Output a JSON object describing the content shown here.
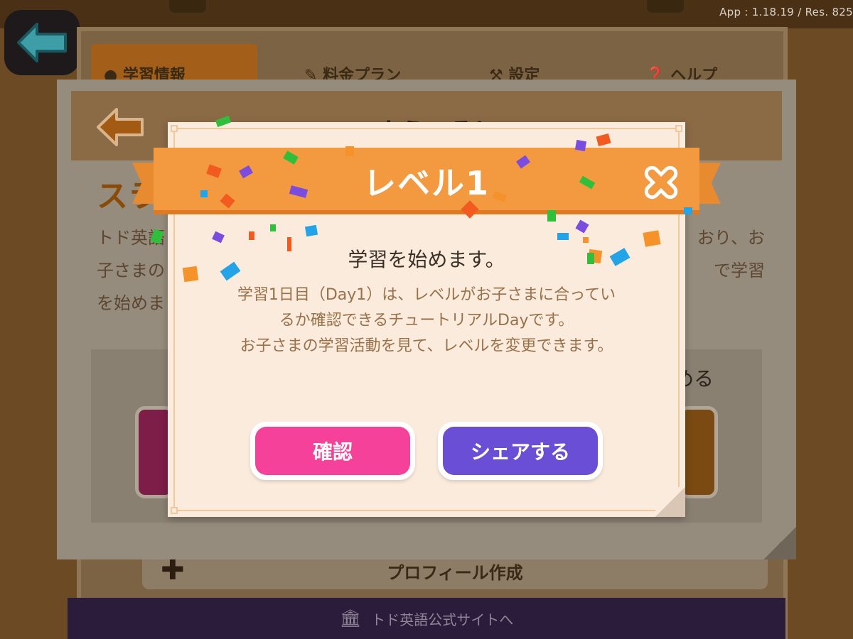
{
  "app": {
    "version": "App : 1.18.19 / Res. 825"
  },
  "background": {
    "tabs": [
      "学習情報",
      "料金プラン",
      "設定",
      "ヘルプ"
    ],
    "card_title": "ようこそ！",
    "card_heading": "スラ",
    "card_text_line1_start": "トド英語",
    "card_text_line1_end": "おり、お",
    "card_text_line2_start": "子さまの",
    "card_text_line2_end": "で学習",
    "card_text_line3": "を始めま",
    "panel_tail": "める",
    "profile_label": "プロフィール作成",
    "footer_link": "トド英語公式サイトへ"
  },
  "popup": {
    "title": "レベル1",
    "message": "学習を始めます。",
    "body_lines": [
      "学習1日目（Day1）は、レベルがお子さまに合ってい",
      "るか確認できるチュートリアルDayです。",
      "お子さまの学習活動を見て、レベルを変更できます。"
    ],
    "confirm_label": "確認",
    "share_label": "シェアする"
  },
  "colors": {
    "ribbon": "#f3993f",
    "confirm": "#f5419a",
    "share": "#6a4fd6",
    "body_text": "#98714a"
  },
  "icons": [
    "back-arrow-icon",
    "close-icon",
    "bank-icon",
    "plus-icon"
  ]
}
